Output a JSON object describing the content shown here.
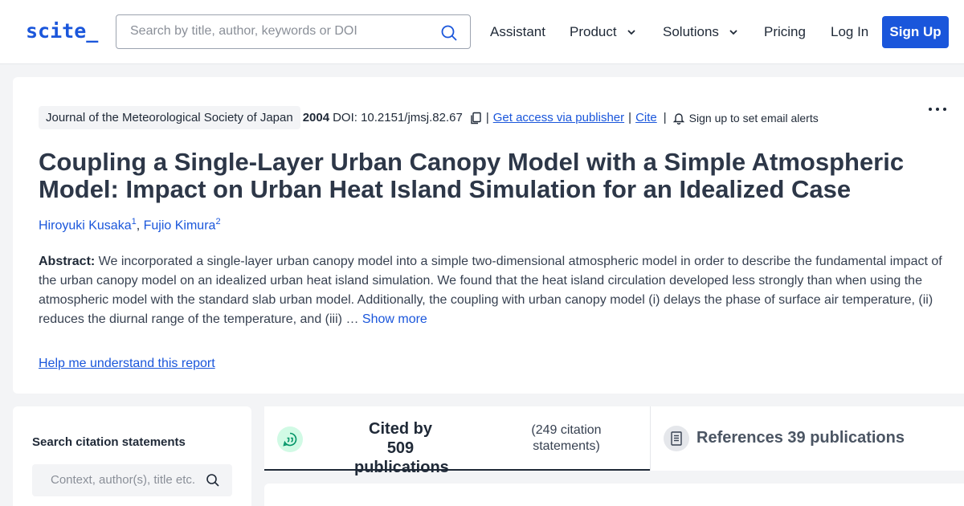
{
  "header": {
    "logo": "scite_",
    "search_placeholder": "Search by title, author, keywords or DOI",
    "nav": {
      "assistant": "Assistant",
      "product": "Product",
      "solutions": "Solutions",
      "pricing": "Pricing",
      "login": "Log In",
      "signup": "Sign Up"
    }
  },
  "paper": {
    "journal": "Journal of the Meteorological Society of Japan",
    "year": "2004",
    "doi": "DOI: 10.2151/jmsj.82.67",
    "sep": "|",
    "access_link": "Get access via publisher",
    "cite_link": "Cite",
    "alert_text": "Sign up to set email alerts",
    "title": "Coupling a Single-Layer Urban Canopy Model with a Simple Atmospheric Model: Impact on Urban Heat Island Simulation for an Idealized Case",
    "authors": [
      {
        "name": "Hiroyuki Kusaka",
        "sup": "1"
      },
      {
        "name": "Fujio Kimura",
        "sup": "2"
      }
    ],
    "author_sep": ", ",
    "abstract_label": "Abstract:",
    "abstract_text": " We incorporated a single-layer urban canopy model into a simple two-dimensional atmospheric model in order to describe the fundamental impact of the urban canopy model on an idealized urban heat island simulation. We found that the heat island circulation developed less strongly than when using the atmospheric model with the standard slab urban model. Additionally, the coupling with urban canopy model (i) delays the phase of surface air temperature, (ii) reduces the diurnal range of the temperature, and (iii) … ",
    "show_more": "Show more",
    "help_link": "Help me understand this report"
  },
  "sidebar": {
    "title": "Search citation statements",
    "placeholder": "Context, author(s), title etc."
  },
  "tabs": {
    "cited_main": "Cited by 509 publications",
    "cited_sub": "(249 citation statements)",
    "references": "References 39 publications"
  },
  "colors": {
    "accent": "#1a56db",
    "badge_green": "#d1fae5",
    "icon_green": "#059669"
  },
  "icons": {
    "search": "search-icon",
    "chevron": "chevron-down-icon",
    "copy": "copy-icon",
    "bell": "bell-icon",
    "more": "more-options-icon",
    "quote": "quote-bubble-icon",
    "document": "document-icon"
  }
}
